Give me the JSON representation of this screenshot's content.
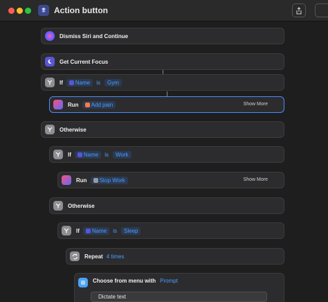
{
  "window": {
    "title": "Action button"
  },
  "actions": {
    "dismiss_siri": {
      "label": "Dismiss Siri and Continue"
    },
    "get_focus": {
      "label": "Get Current Focus"
    },
    "if_gym": {
      "keyword": "If",
      "variable": "Name",
      "operator": "is",
      "value": "Gym"
    },
    "run_add_pain": {
      "keyword": "Run",
      "shortcut": "Add pain",
      "show_more": "Show More"
    },
    "otherwise_1": {
      "label": "Otherwise"
    },
    "if_work": {
      "keyword": "If",
      "variable": "Name",
      "operator": "is",
      "value": "Work"
    },
    "run_stop_work": {
      "keyword": "Run",
      "shortcut": "Stop Work",
      "show_more": "Show More"
    },
    "otherwise_2": {
      "label": "Otherwise"
    },
    "if_sleep": {
      "keyword": "If",
      "variable": "Name",
      "operator": "is",
      "value": "Sleep"
    },
    "repeat": {
      "keyword": "Repeat",
      "count": "4 times"
    },
    "choose_menu": {
      "label": "Choose from menu with",
      "prompt": "Prompt",
      "option": "Dictate text"
    }
  },
  "colors": {
    "accent": "#4a9eff",
    "selection": "#4a8cff",
    "card": "#2c2c2e",
    "background": "#1e1e1e"
  },
  "icons": [
    "siri-icon",
    "focus-moon-icon",
    "if-branch-icon",
    "shortcut-icon",
    "repeat-icon",
    "menu-icon",
    "share-icon"
  ]
}
